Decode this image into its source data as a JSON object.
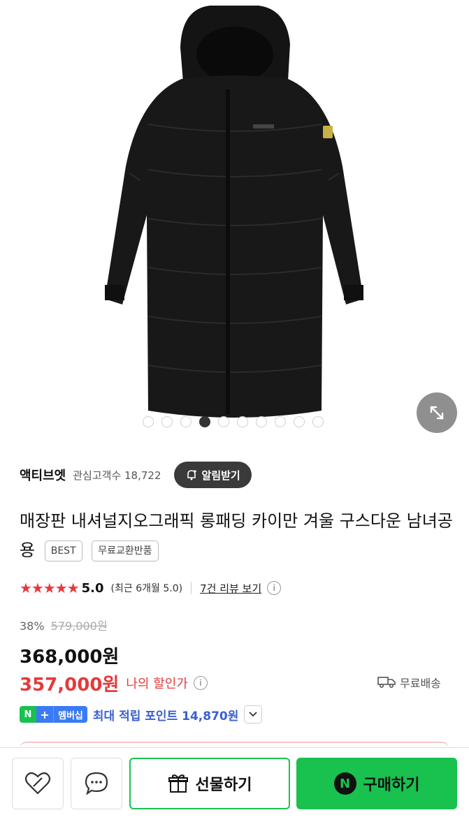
{
  "product": {
    "image_alt": "black long padded down coat",
    "carousel": {
      "total": 10,
      "active_index": 3
    }
  },
  "store": {
    "name": "액티브엣",
    "followers_label": "관심고객수 18,722",
    "notify_label": "알림받기"
  },
  "title": {
    "text": "매장판 내셔널지오그래픽 롱패딩 카이만 겨울 구스다운 남녀공용",
    "tags": [
      "BEST",
      "무료교환반품"
    ]
  },
  "rating": {
    "stars": 5,
    "score": "5.0",
    "recent": "(최근 6개월 5.0)",
    "review_link": "7건 리뷰 보기"
  },
  "price": {
    "discount_pct": "38%",
    "original": "579,000원",
    "sale": "368,000원",
    "my_price": "357,000원",
    "my_price_label": "나의 할인가",
    "shipping": "무료배송"
  },
  "points": {
    "badge_n": "N",
    "badge_plus": "+",
    "badge_member": "멤버십",
    "text": "최대 적립 포인트 14,870원"
  },
  "bottom_bar": {
    "gift_label": "선물하기",
    "buy_label": "구매하기",
    "buy_logo": "N"
  },
  "colors": {
    "accent_green": "#19c14f",
    "price_red": "#e43b3b",
    "star_red": "#e8383d",
    "membership_blue": "#3a7bf5"
  }
}
